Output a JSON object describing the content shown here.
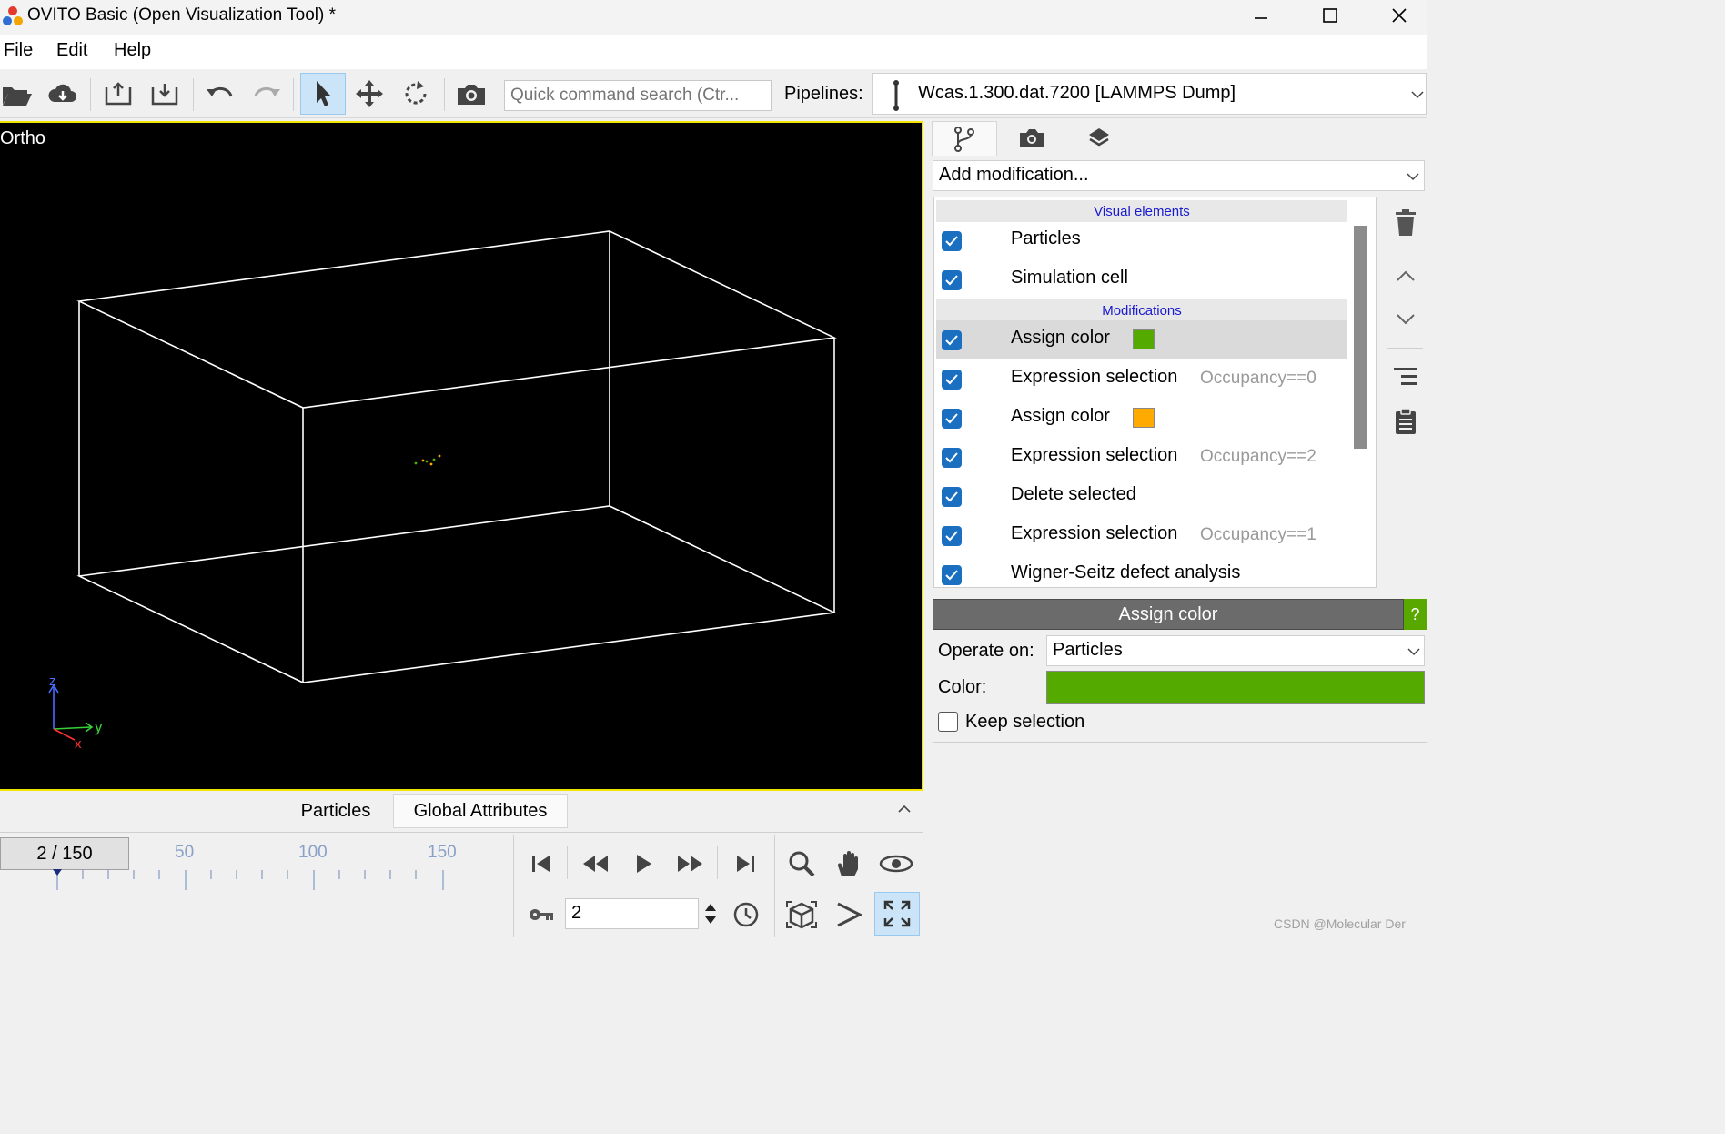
{
  "window": {
    "title": "OVITO Basic (Open Visualization Tool) *"
  },
  "menu": {
    "items": [
      "File",
      "Edit",
      "Help"
    ]
  },
  "toolbar": {
    "search_placeholder": "Quick command search (Ctr...",
    "pipelines_label": "Pipelines:",
    "pipeline_name": "Wcas.1.300.dat.7200 [LAMMPS Dump]"
  },
  "viewport": {
    "caption": "Ortho",
    "axes": {
      "z": "z",
      "y": "y",
      "x": "x"
    },
    "frame_color": "#f2e600"
  },
  "bottom_tabs": {
    "particles": "Particles",
    "global_attributes": "Global Attributes"
  },
  "animation": {
    "frame_display": "2 / 150",
    "ticks": [
      "50",
      "100",
      "150"
    ],
    "current_frame": "2"
  },
  "right_panel": {
    "add_modification": "Add modification...",
    "visual_elements_header": "Visual elements",
    "modifications_header": "Modifications",
    "visual_elements": [
      {
        "label": "Particles",
        "checked": true
      },
      {
        "label": "Simulation cell",
        "checked": true
      }
    ],
    "modifications": [
      {
        "label": "Assign color",
        "checked": true,
        "swatch": "#55aa00",
        "status": ""
      },
      {
        "label": "Expression selection",
        "checked": true,
        "status": "Occupancy==0"
      },
      {
        "label": "Assign color",
        "checked": true,
        "swatch": "#ffaa00",
        "status": ""
      },
      {
        "label": "Expression selection",
        "checked": true,
        "status": "Occupancy==2"
      },
      {
        "label": "Delete selected",
        "checked": true,
        "status": ""
      },
      {
        "label": "Expression selection",
        "checked": true,
        "status": "Occupancy==1"
      },
      {
        "label": "Wigner-Seitz defect analysis",
        "checked": true,
        "status": ""
      }
    ]
  },
  "properties": {
    "title": "Assign color",
    "help": "?",
    "operate_on_label": "Operate on:",
    "operate_on_value": "Particles",
    "color_label": "Color:",
    "color_value": "#55aa00",
    "keep_selection_label": "Keep selection",
    "keep_selection_checked": false
  },
  "watermark": "CSDN @Molecular Der"
}
